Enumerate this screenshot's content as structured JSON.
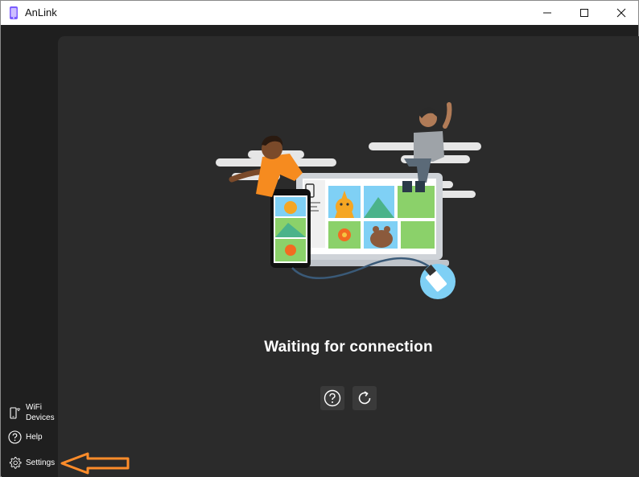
{
  "window": {
    "title": "AnLink"
  },
  "sidebar": {
    "items": [
      {
        "label_line1": "WiFi",
        "label_line2": "Devices",
        "icon": "phone-wifi-icon"
      },
      {
        "label": "Help",
        "icon": "help-circle-icon"
      },
      {
        "label": "Settings",
        "icon": "gear-icon"
      }
    ]
  },
  "main": {
    "status": "Waiting for connection",
    "actions": [
      {
        "icon": "help-circle-icon"
      },
      {
        "icon": "refresh-icon"
      }
    ]
  },
  "colors": {
    "background": "#1f1f1f",
    "content": "#2b2b2b",
    "accent_arrow": "#ff8c2a",
    "usb_badge": "#7fd0f5"
  }
}
